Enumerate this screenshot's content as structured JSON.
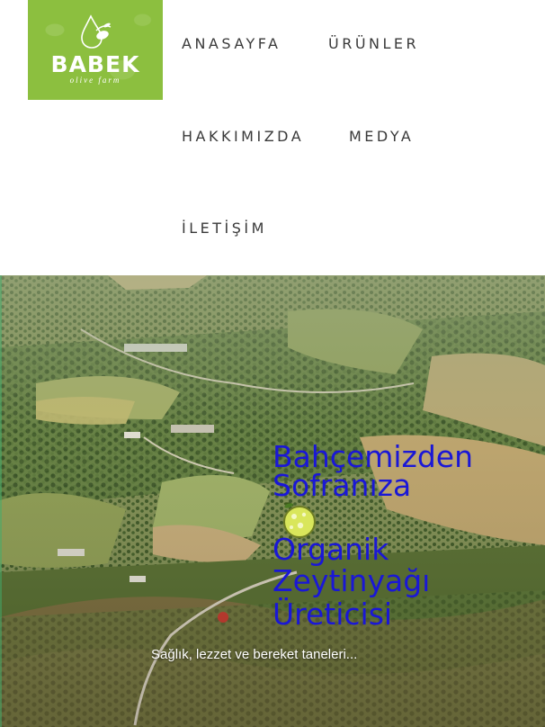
{
  "logo": {
    "name": "BABEK",
    "subtitle": "olive farm"
  },
  "nav": {
    "home": "ANASAYFA",
    "products": "ÜRÜNLER",
    "about": "HAKKIMIZDA",
    "media": "MEDYA",
    "contact": "İLETİŞİM"
  },
  "hero": {
    "heading_line1": "Bahçemizden",
    "heading_line2": "Sofranıza",
    "heading_line3": "Organik",
    "heading_line4": "Zeytinyağı",
    "heading_line5": "Üreticisi",
    "tagline": "Sağlık, lezzet ve bereket taneleri..."
  },
  "colors": {
    "brand_green": "#8cbf3f",
    "heading_blue": "#1a17d6",
    "nav_text": "#3a3a3a"
  },
  "icons": {
    "logo": "olive-drop-icon",
    "decor": "olive-icon"
  }
}
